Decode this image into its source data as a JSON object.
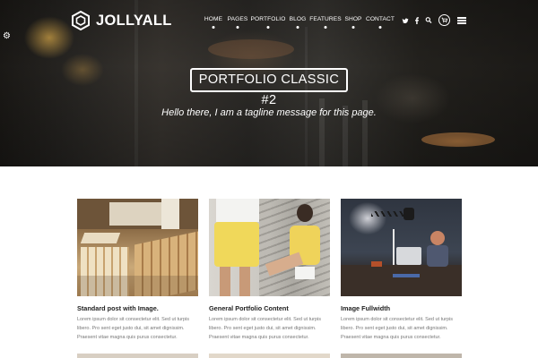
{
  "brand": {
    "name": "JOLLYALL"
  },
  "nav": {
    "items": [
      {
        "label": "HOME"
      },
      {
        "label": "PAGES"
      },
      {
        "label": "PORTFOLIO"
      },
      {
        "label": "BLOG"
      },
      {
        "label": "FEATURES"
      },
      {
        "label": "SHOP"
      },
      {
        "label": "CONTACT"
      }
    ],
    "icons": [
      "twitter-icon",
      "facebook-icon",
      "search-icon",
      "cart-icon",
      "menu-icon"
    ]
  },
  "hero": {
    "title": "PORTFOLIO CLASSIC #2",
    "tagline": "Hello there, I am a tagline message for this page."
  },
  "portfolio": {
    "items": [
      {
        "title": "Standard post with Image.",
        "lines": [
          "Lorem ipsum dolor sit consectetur elit. Sed ut turpis",
          "libero. Pro sent eget justo dui, sit amet dignissim.",
          "Praesent vitae magna quis purus consectetur."
        ]
      },
      {
        "title": "General Portfolio Content",
        "lines": [
          "Lorem ipsum dolor sit consectetur elit. Sed ut turpis",
          "libero. Pro sent eget justo dui, sit amet dignissim.",
          "Praesent vitae magna quis purus consectetur."
        ]
      },
      {
        "title": "Image Fullwidth",
        "lines": [
          "Lorem ipsum dolor sit consectetur elit. Sed ut turpis",
          "libero. Pro sent eget justo dui, sit amet dignissim.",
          "Praesent vitae magna quis purus consectetur."
        ]
      }
    ]
  },
  "colors": {
    "text": "#222222",
    "muted": "#777777",
    "white": "#ffffff"
  }
}
